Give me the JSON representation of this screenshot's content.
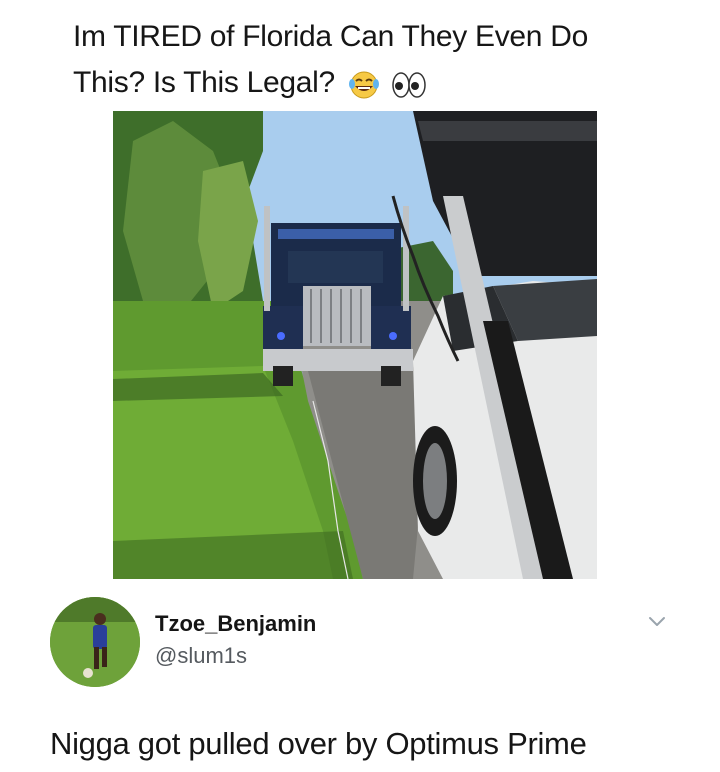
{
  "post": {
    "caption_line1": "Im TIRED of Florida Can They Even Do",
    "caption_line2": "This? Is This Legal?",
    "emojis": [
      "face-with-tears-of-joy-icon",
      "eyes-icon"
    ]
  },
  "image": {
    "subject": "photo"
  },
  "author": {
    "display_name": "Tzoe_Benjamin",
    "handle": "@slum1s"
  },
  "reply": {
    "text": "Nigga got pulled over by Optimus Prime"
  },
  "colors": {
    "text": "#161616",
    "handle": "#555a5f",
    "chevron": "#9aa4ad"
  }
}
